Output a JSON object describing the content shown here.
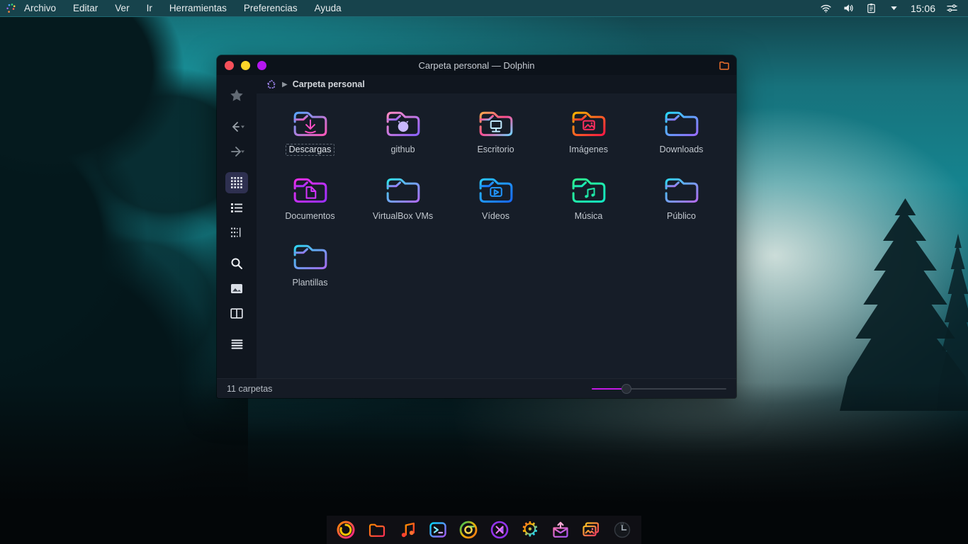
{
  "menubar": {
    "items": [
      "Archivo",
      "Editar",
      "Ver",
      "Ir",
      "Herramientas",
      "Preferencias",
      "Ayuda"
    ],
    "clock": "15:06",
    "tray_icons": [
      "wifi",
      "volume",
      "clipboard",
      "chevron-down",
      "clock",
      "tune-sliders"
    ]
  },
  "window": {
    "title": "Carpeta personal — Dolphin",
    "traffic_lights": {
      "close": "#f6505a",
      "minimize": "#ffd629",
      "maximize": "#b517f0"
    },
    "breadcrumb": {
      "location": "Carpeta personal"
    },
    "sidebar_tools": [
      "favorites-star",
      "back",
      "forward",
      "grid-view",
      "list-view",
      "compact-view",
      "search",
      "preview",
      "split-view",
      "menu"
    ],
    "folders": [
      {
        "name": "Descargas",
        "stops": [
          "#58a6ff",
          "#ff57b8"
        ],
        "glyph": "download",
        "glyph_color": "#ff4fc4",
        "selected": true
      },
      {
        "name": "github",
        "stops": [
          "#ff8ac2",
          "#8a63ff"
        ],
        "glyph": "github",
        "glyph_color": "#c9b8ff"
      },
      {
        "name": "Escritorio",
        "stops": [
          "#ffa94d",
          "#ff4d94",
          "#6fd3ff"
        ],
        "glyph": "monitor",
        "glyph_color": "#bfe9ff"
      },
      {
        "name": "Imágenes",
        "stops": [
          "#ffb300",
          "#ff1744"
        ],
        "glyph": "image",
        "glyph_color": "#ff2e5e"
      },
      {
        "name": "Downloads",
        "stops": [
          "#29d8ff",
          "#9a6bff"
        ],
        "glyph": "none"
      },
      {
        "name": "Documentos",
        "stops": [
          "#ea2ee6",
          "#9b30ff"
        ],
        "glyph": "document",
        "glyph_color": "#d633ff"
      },
      {
        "name": "VirtualBox VMs",
        "stops": [
          "#2fe0e8",
          "#b06bff"
        ],
        "glyph": "none"
      },
      {
        "name": "Vídeos",
        "stops": [
          "#29c5ff",
          "#1769ff"
        ],
        "glyph": "video",
        "glyph_color": "#2196ff"
      },
      {
        "name": "Música",
        "stops": [
          "#2ef08e",
          "#13e6c2"
        ],
        "glyph": "music",
        "glyph_color": "#1fe8a8"
      },
      {
        "name": "Público",
        "stops": [
          "#2fd4f0",
          "#b36bf0"
        ],
        "glyph": "none"
      },
      {
        "name": "Plantillas",
        "stops": [
          "#2fd4f0",
          "#a66bf0"
        ],
        "glyph": "none"
      }
    ],
    "status": {
      "items_text": "11 carpetas",
      "zoom_slider": {
        "fill_percent": 24,
        "fill_color": "#c21ae5"
      }
    }
  },
  "dock": {
    "items": [
      "firefox",
      "file-manager",
      "music-player",
      "terminal",
      "chromium",
      "code-editor",
      "settings",
      "mail",
      "gallery",
      "clock-widget"
    ]
  }
}
